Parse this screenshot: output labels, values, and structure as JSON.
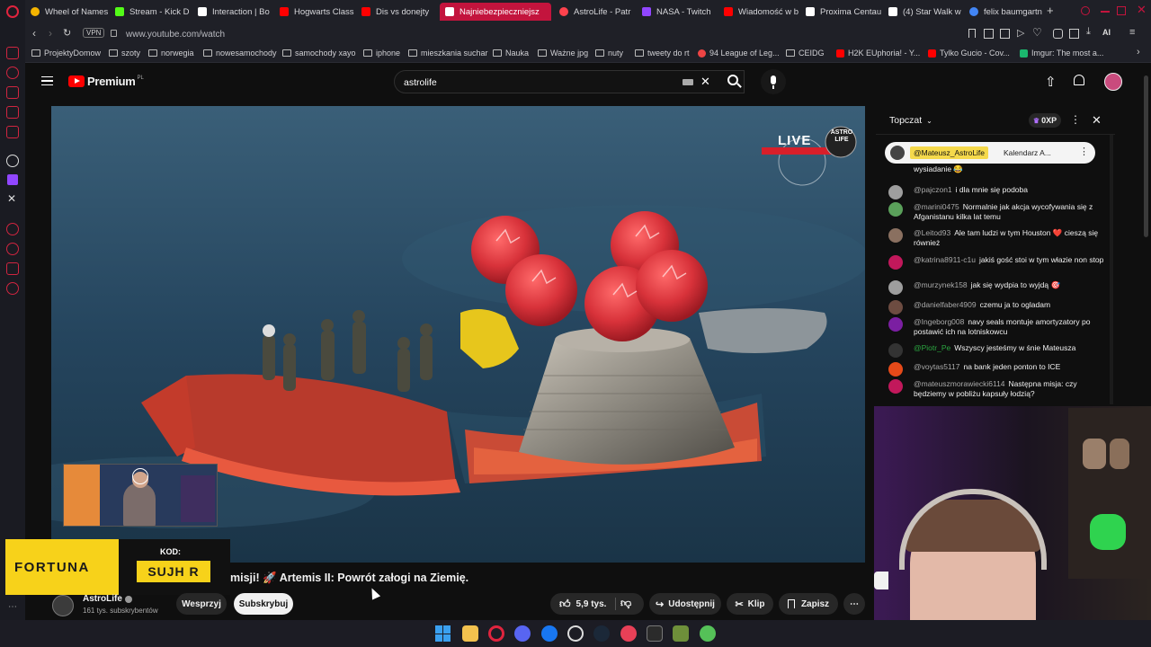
{
  "browser": {
    "tabs": [
      {
        "label": "Wheel of Names",
        "color": "#f4b400"
      },
      {
        "label": "Stream - Kick D",
        "color": "#53fc18"
      },
      {
        "label": "Interaction | Bo",
        "color": "#ffffff"
      },
      {
        "label": "Hogwarts Class",
        "color": "#ff0000"
      },
      {
        "label": "Dis vs donejty",
        "color": "#ff0000"
      },
      {
        "label": "Najniebezpieczniejsz",
        "color": "#ff0000",
        "active": true
      },
      {
        "label": "AstroLife - Patr",
        "color": "#ff424d"
      },
      {
        "label": "NASA - Twitch",
        "color": "#9146ff"
      },
      {
        "label": "Wiadomość w b",
        "color": "#ff0000"
      },
      {
        "label": "Proxima Centau",
        "color": "#ffffff"
      },
      {
        "label": "(4) Star Walk w",
        "color": "#ffffff"
      },
      {
        "label": "felix baumgartn",
        "color": "#4285f4"
      }
    ],
    "vpn_label": "VPN",
    "url": "www.youtube.com/watch",
    "bookmarks": [
      {
        "label": "ProjektyDomow",
        "type": "folder"
      },
      {
        "label": "szoty",
        "type": "folder"
      },
      {
        "label": "norwegia",
        "type": "folder"
      },
      {
        "label": "nowesamochody",
        "type": "folder"
      },
      {
        "label": "samochody xayo",
        "type": "folder"
      },
      {
        "label": "iphone",
        "type": "folder"
      },
      {
        "label": "mieszkania suchar",
        "type": "folder"
      },
      {
        "label": "Nauka",
        "type": "folder"
      },
      {
        "label": "Ważne jpg",
        "type": "folder"
      },
      {
        "label": "nuty",
        "type": "folder"
      },
      {
        "label": "tweety do rt",
        "type": "folder"
      },
      {
        "label": "94 League of Leg...",
        "type": "site"
      },
      {
        "label": "CEIDG",
        "type": "folder"
      },
      {
        "label": "H2K EUphoria! - Y...",
        "type": "site"
      },
      {
        "label": "Tylko Gucio - Cov...",
        "type": "site"
      },
      {
        "label": "Imgur: The most a...",
        "type": "site"
      }
    ],
    "ai_label": "AI"
  },
  "youtube": {
    "logo_text": "Premium",
    "logo_region": "PL",
    "search_value": "astrolife",
    "video_title": "misji! 🚀 Artemis II: Powrót załogi na Ziemię.",
    "channel_name": "AstroLife",
    "subscribers": "161 tys. subskrybentów",
    "support_label": "Wesprzyj",
    "subscribe_label": "Subskrybuj",
    "likes": "5,9 tys.",
    "share_label": "Udostępnij",
    "clip_label": "Klip",
    "save_label": "Zapisz",
    "live_badge": "LIVE",
    "astro_badge": "ASTRO LIFE"
  },
  "sponsor": {
    "brand": "FORTUNA",
    "code_label": "KOD:",
    "code_value": "SUJH R"
  },
  "chat": {
    "mode_label": "Topczat",
    "points_label": "0XP",
    "pinned_user": "@Mateusz_AstroLife",
    "pinned_text": "Kalendarz A...",
    "messages": [
      {
        "user": "",
        "text": "wysiadanie 😂",
        "color": "#888"
      },
      {
        "user": "@pajczon1",
        "text": "i dla mnie się podoba",
        "color": "#9e9e9e"
      },
      {
        "user": "@marini0475",
        "text": "Normalnie jak akcja wycofywania się z Afganistanu kilka lat temu",
        "color": "#5aa05a"
      },
      {
        "user": "@Leitod93",
        "text": "Ale tam ludzi w tym Houston ❤️ cieszą się również",
        "color": "#8a7060"
      },
      {
        "user": "@katrina8911-c1u",
        "text": "jakiś gość stoi w tym włazie non stop",
        "color": "#c2185b"
      },
      {
        "user": "@murzynek158",
        "text": "jak się wydpia to wyjdą 🎯",
        "color": "#9e9e9e"
      },
      {
        "user": "@danielfaber4909",
        "text": "czemu ja to ogladam",
        "color": "#6d4c41"
      },
      {
        "user": "@Ingeborg008",
        "text": "navy seals montuje amortyzatory po postawić ich na lotniskowcu",
        "color": "#7b1fa2"
      },
      {
        "user": "@Piotr_Pe",
        "text": "Wszyscy jesteśmy w śnie Mateusza",
        "color": "#333"
      },
      {
        "user": "@voytas5117",
        "text": "na bank jeden ponton to ICE",
        "color": "#e64a19"
      },
      {
        "user": "@mateuszmorawiecki6114",
        "text": "Następna misja: czy będziemy w pobliżu kapsuły łodzią?",
        "color": "#c2185b"
      }
    ]
  },
  "colors": {
    "accent": "#c3143d",
    "yt_red": "#ff0000",
    "fortuna_yellow": "#f7d21a"
  }
}
